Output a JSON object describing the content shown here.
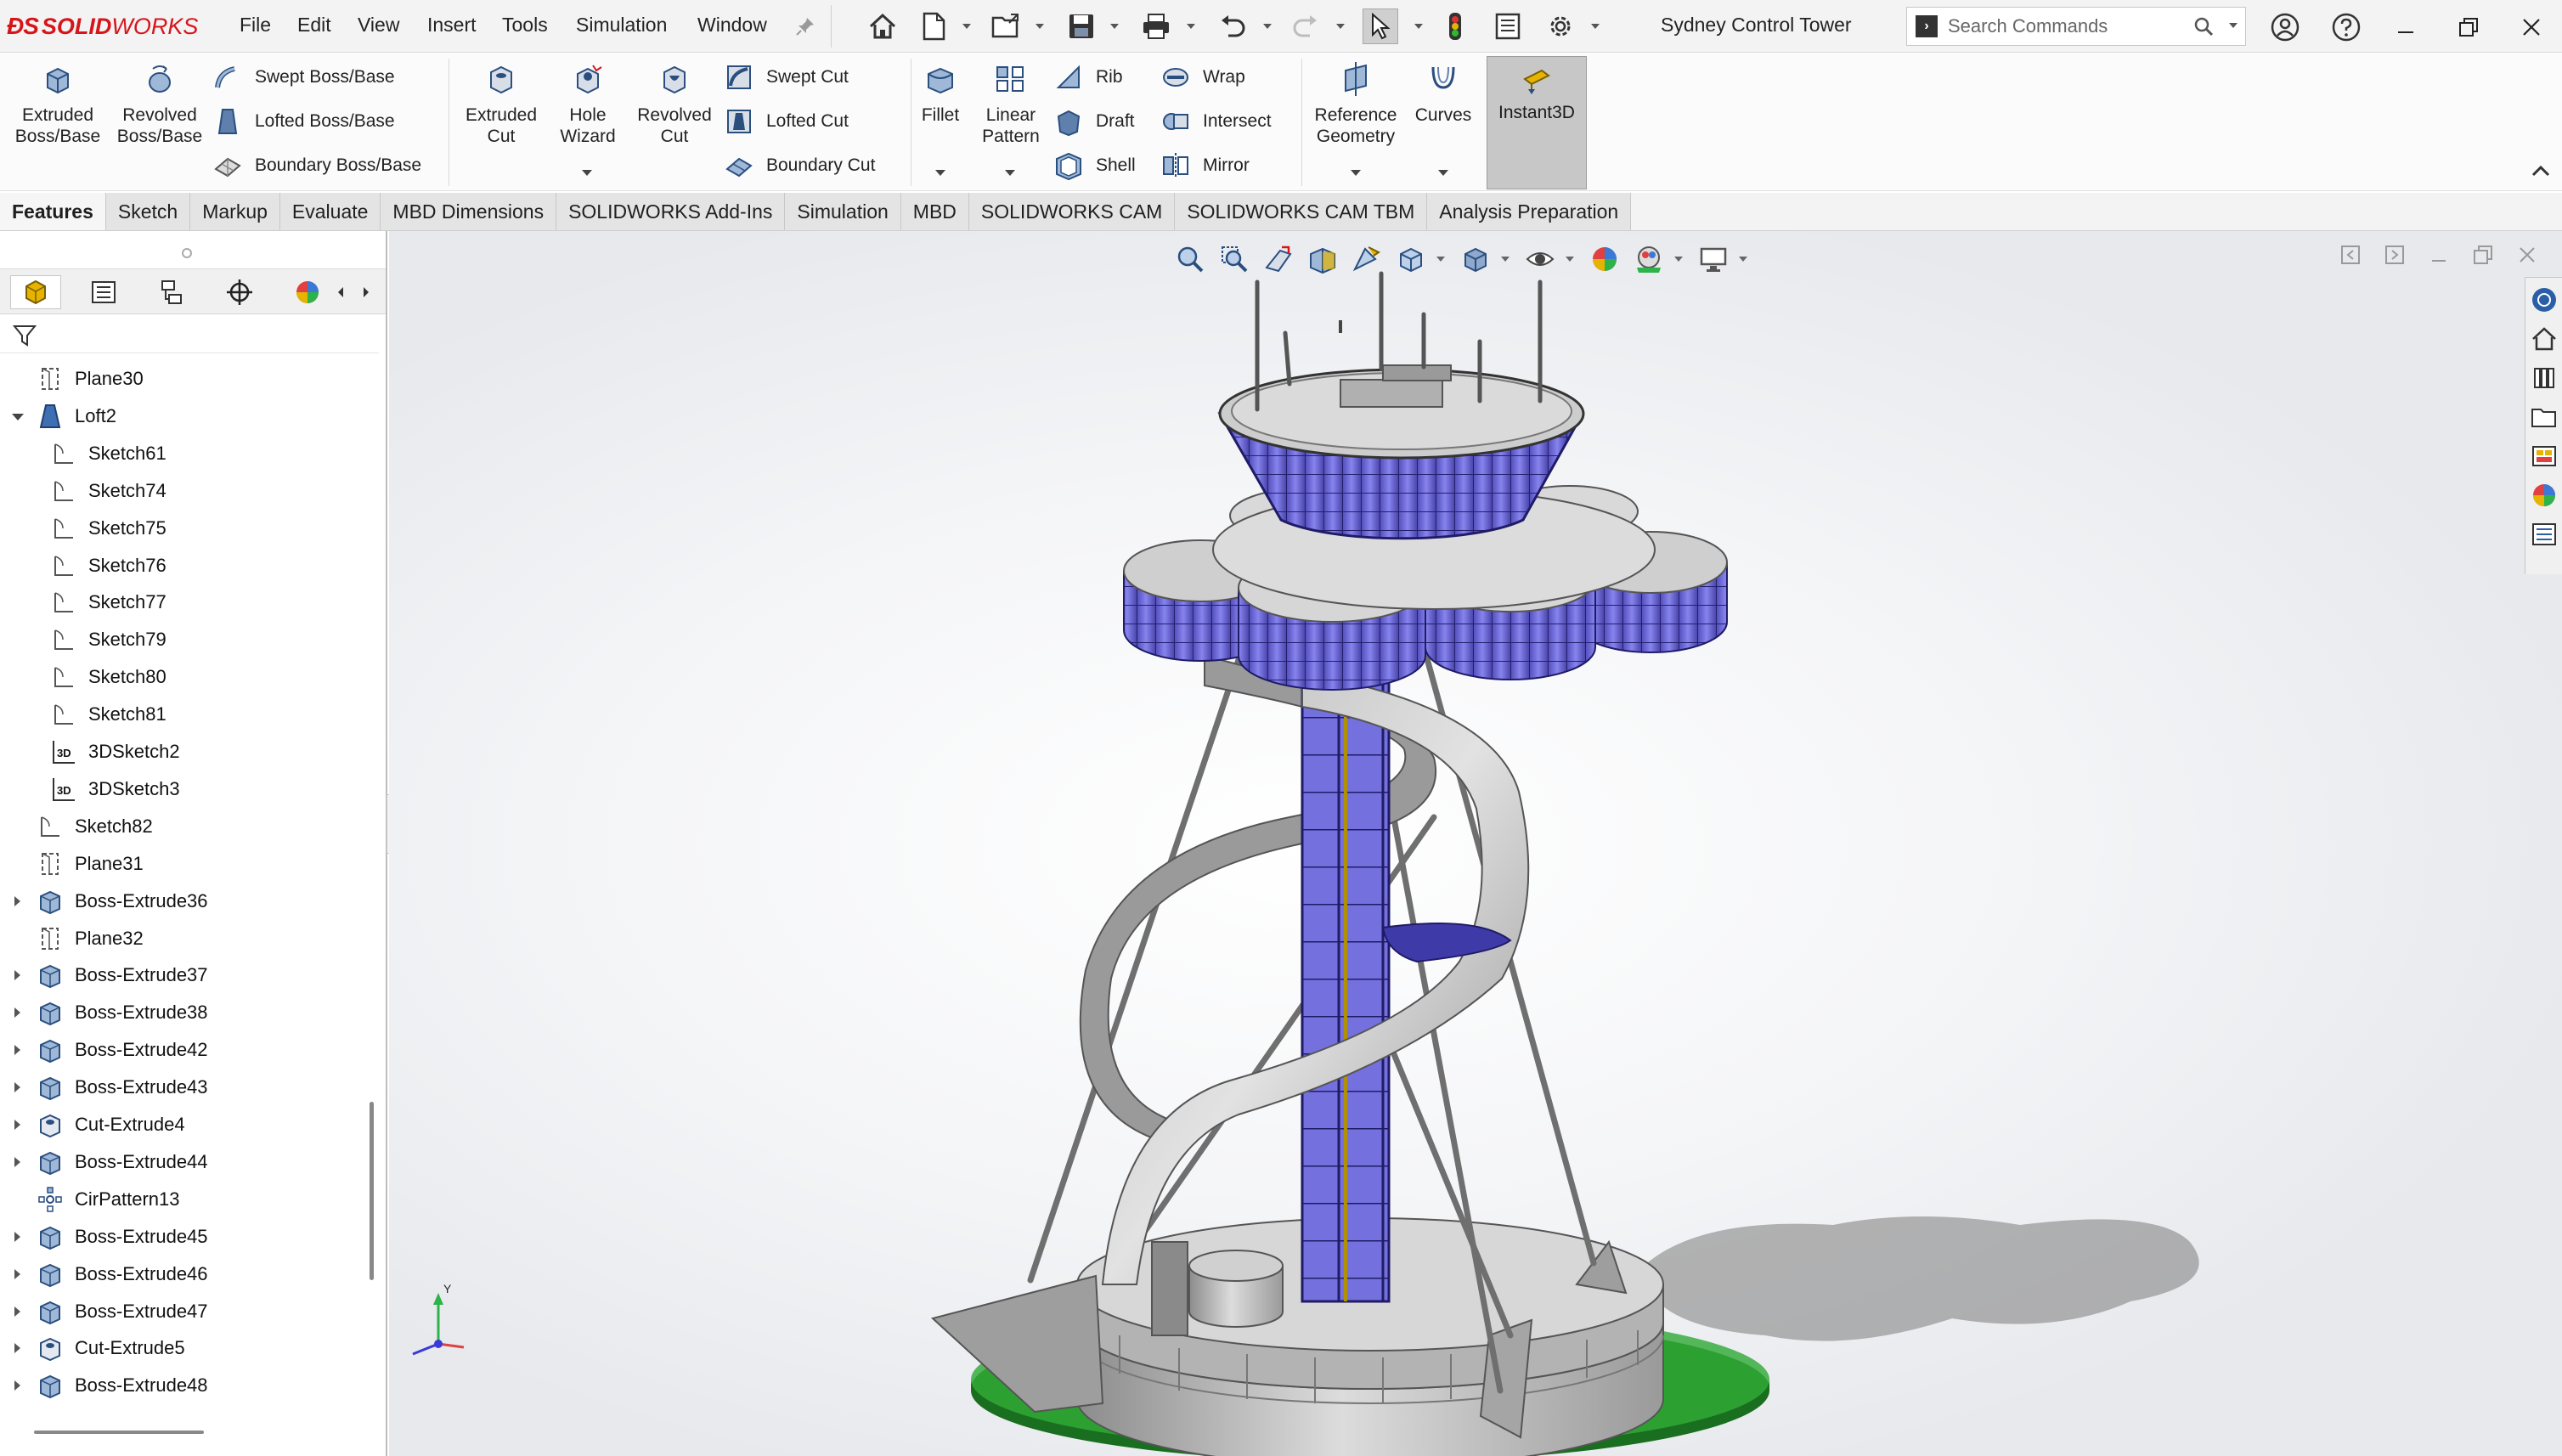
{
  "app": {
    "brand_prefix": "SOLID",
    "brand_suffix": "WORKS",
    "document_title": "Sydney Control Tower"
  },
  "menu": [
    "File",
    "Edit",
    "View",
    "Insert",
    "Tools",
    "Simulation",
    "Window"
  ],
  "search": {
    "placeholder": "Search Commands"
  },
  "ribbon": {
    "extruded_boss": "Extruded Boss/Base",
    "revolved_boss": "Revolved Boss/Base",
    "swept_boss": "Swept Boss/Base",
    "lofted_boss": "Lofted Boss/Base",
    "boundary_boss": "Boundary Boss/Base",
    "extruded_cut": "Extruded Cut",
    "hole_wizard": "Hole Wizard",
    "revolved_cut": "Revolved Cut",
    "swept_cut": "Swept Cut",
    "lofted_cut": "Lofted Cut",
    "boundary_cut": "Boundary Cut",
    "fillet": "Fillet",
    "linear_pattern": "Linear Pattern",
    "rib": "Rib",
    "draft": "Draft",
    "shell": "Shell",
    "wrap": "Wrap",
    "intersect": "Intersect",
    "mirror": "Mirror",
    "reference_geometry": "Reference Geometry",
    "curves": "Curves",
    "instant3d": "Instant3D"
  },
  "tabs": [
    "Features",
    "Sketch",
    "Markup",
    "Evaluate",
    "MBD Dimensions",
    "SOLIDWORKS Add-Ins",
    "Simulation",
    "MBD",
    "SOLIDWORKS CAM",
    "SOLIDWORKS CAM TBM",
    "Analysis Preparation"
  ],
  "tree": [
    {
      "label": "Plane30",
      "icon": "plane-icon",
      "level": 1,
      "toggle": "none"
    },
    {
      "label": "Loft2",
      "icon": "loft-icon",
      "level": 1,
      "toggle": "open"
    },
    {
      "label": "Sketch61",
      "icon": "sketch-icon",
      "level": 2,
      "toggle": "none"
    },
    {
      "label": "Sketch74",
      "icon": "sketch-icon",
      "level": 2,
      "toggle": "none"
    },
    {
      "label": "Sketch75",
      "icon": "sketch-icon",
      "level": 2,
      "toggle": "none"
    },
    {
      "label": "Sketch76",
      "icon": "sketch-icon",
      "level": 2,
      "toggle": "none"
    },
    {
      "label": "Sketch77",
      "icon": "sketch-icon",
      "level": 2,
      "toggle": "none"
    },
    {
      "label": "Sketch79",
      "icon": "sketch-icon",
      "level": 2,
      "toggle": "none"
    },
    {
      "label": "Sketch80",
      "icon": "sketch-icon",
      "level": 2,
      "toggle": "none"
    },
    {
      "label": "Sketch81",
      "icon": "sketch-icon",
      "level": 2,
      "toggle": "none"
    },
    {
      "label": "3DSketch2",
      "icon": "3dsketch-icon",
      "level": 2,
      "toggle": "none"
    },
    {
      "label": "3DSketch3",
      "icon": "3dsketch-icon",
      "level": 2,
      "toggle": "none"
    },
    {
      "label": "Sketch82",
      "icon": "sketch-icon",
      "level": 1,
      "toggle": "none"
    },
    {
      "label": "Plane31",
      "icon": "plane-icon",
      "level": 1,
      "toggle": "none"
    },
    {
      "label": "Boss-Extrude36",
      "icon": "extrude-icon",
      "level": 1,
      "toggle": "closed"
    },
    {
      "label": "Plane32",
      "icon": "plane-icon",
      "level": 1,
      "toggle": "none"
    },
    {
      "label": "Boss-Extrude37",
      "icon": "extrude-icon",
      "level": 1,
      "toggle": "closed"
    },
    {
      "label": "Boss-Extrude38",
      "icon": "extrude-icon",
      "level": 1,
      "toggle": "closed"
    },
    {
      "label": "Boss-Extrude42",
      "icon": "extrude-icon",
      "level": 1,
      "toggle": "closed"
    },
    {
      "label": "Boss-Extrude43",
      "icon": "extrude-icon",
      "level": 1,
      "toggle": "closed"
    },
    {
      "label": "Cut-Extrude4",
      "icon": "cut-extrude-icon",
      "level": 1,
      "toggle": "closed"
    },
    {
      "label": "Boss-Extrude44",
      "icon": "extrude-icon",
      "level": 1,
      "toggle": "closed"
    },
    {
      "label": "CirPattern13",
      "icon": "circular-pattern-icon",
      "level": 1,
      "toggle": "none"
    },
    {
      "label": "Boss-Extrude45",
      "icon": "extrude-icon",
      "level": 1,
      "toggle": "closed"
    },
    {
      "label": "Boss-Extrude46",
      "icon": "extrude-icon",
      "level": 1,
      "toggle": "closed"
    },
    {
      "label": "Boss-Extrude47",
      "icon": "extrude-icon",
      "level": 1,
      "toggle": "closed"
    },
    {
      "label": "Cut-Extrude5",
      "icon": "cut-extrude-icon",
      "level": 1,
      "toggle": "closed"
    },
    {
      "label": "Boss-Extrude48",
      "icon": "extrude-icon",
      "level": 1,
      "toggle": "closed"
    }
  ],
  "triad": {
    "y_label": "Y"
  },
  "colors": {
    "accent_red": "#d6151b",
    "glass_blue": "#6b67d8",
    "ground_green": "#1f8a1f",
    "concrete_grey": "#b9b9b9"
  }
}
